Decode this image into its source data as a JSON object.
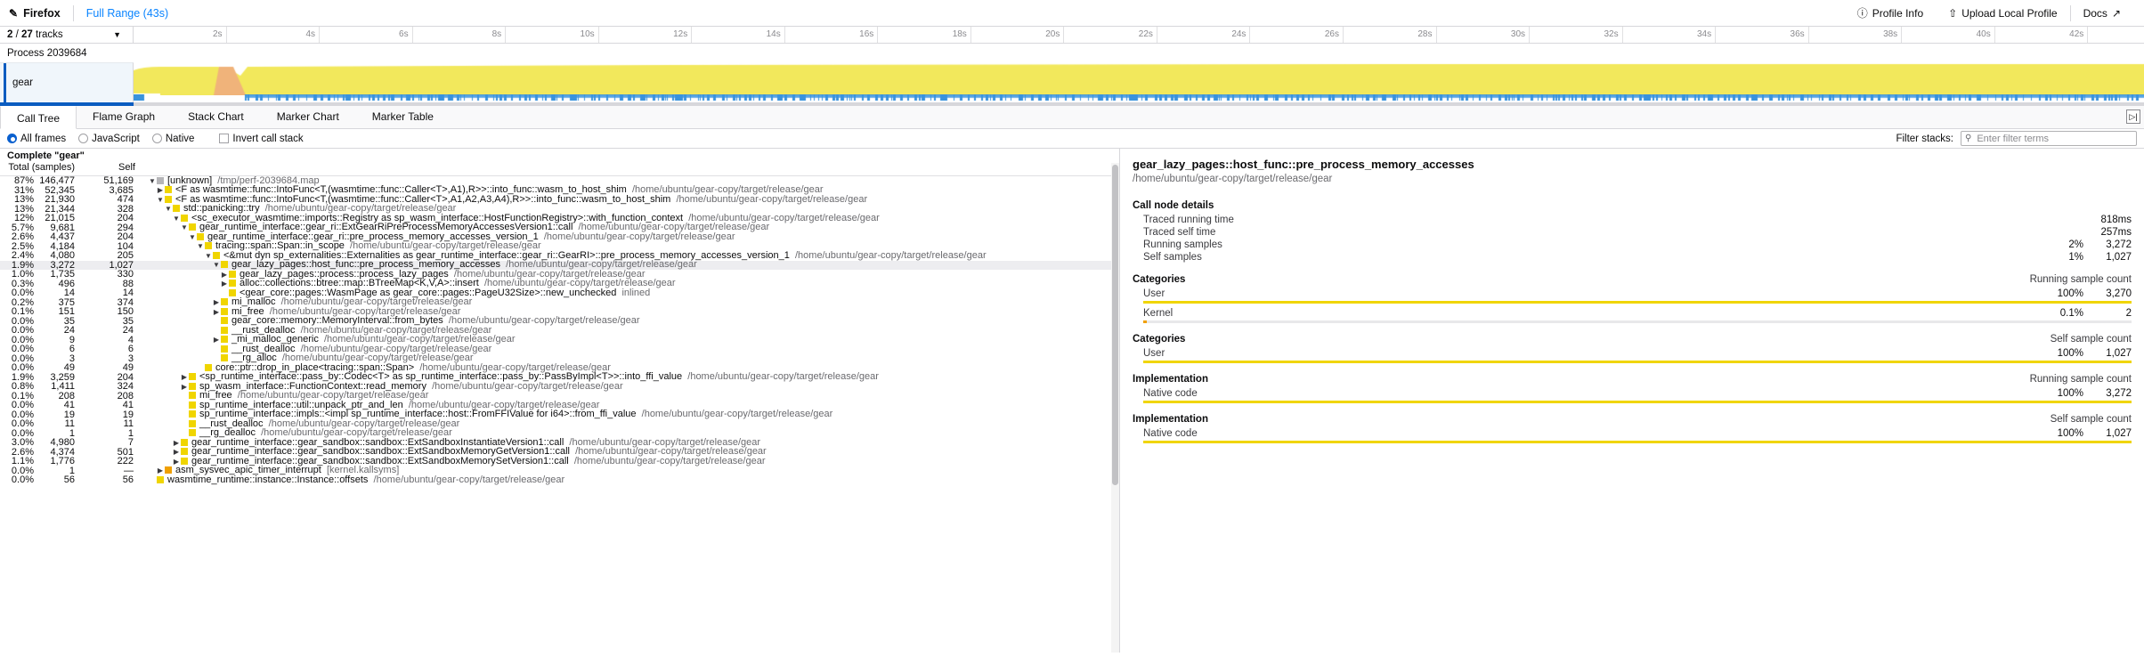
{
  "appbar": {
    "brand": "Firefox",
    "pencil_icon": "pencil-icon",
    "full_range": "Full Range (43s)",
    "profile_info": "Profile Info",
    "upload_local_profile": "Upload Local Profile",
    "docs": "Docs",
    "info_icon": "info-circle-icon",
    "upload_icon": "upload-icon",
    "external_icon": "external-link-icon"
  },
  "timeline": {
    "tracks_selected": "2",
    "tracks_total": "27",
    "tracks_suffix": "tracks",
    "ticks": [
      "2s",
      "4s",
      "6s",
      "8s",
      "10s",
      "12s",
      "14s",
      "16s",
      "18s",
      "20s",
      "22s",
      "24s",
      "26s",
      "28s",
      "30s",
      "32s",
      "34s",
      "36s",
      "38s",
      "40s",
      "42s"
    ],
    "process_label": "Process 2039684",
    "track_name": "gear",
    "activity_color": "#f2e85c",
    "activity_alt_color": "#f0b37a",
    "samples_color": "#3a93dd"
  },
  "tabs": {
    "items": [
      {
        "label": "Call Tree",
        "active": true
      },
      {
        "label": "Flame Graph",
        "active": false
      },
      {
        "label": "Stack Chart",
        "active": false
      },
      {
        "label": "Marker Chart",
        "active": false
      },
      {
        "label": "Marker Table",
        "active": false
      }
    ],
    "sidebar_toggle_icon": "sidebar-toggle-icon"
  },
  "filters": {
    "all_frames": "All frames",
    "javascript": "JavaScript",
    "native": "Native",
    "invert_call_stack": "Invert call stack",
    "selected_frame_filter": "All frames",
    "invert_checked": false,
    "filter_stacks_label": "Filter stacks:",
    "search_placeholder": "Enter filter terms",
    "search_value": "",
    "search_icon": "search-icon"
  },
  "tree": {
    "columns": [
      "Total (samples)",
      "Self",
      ""
    ],
    "col_total": "Total (samples)",
    "col_self": "Self",
    "complete_label": "Complete \"gear\"",
    "rows": [
      {
        "pct": "87%",
        "total": "146,477",
        "self": "51,169",
        "depth": 0,
        "tw": "down",
        "sq": "g",
        "name": "[unknown]",
        "path": "/tmp/perf-2039684.map",
        "sel": false
      },
      {
        "pct": "31%",
        "total": "52,345",
        "self": "3,685",
        "depth": 1,
        "tw": "right",
        "sq": "y",
        "name": "<F as wasmtime::func::IntoFunc<T,(wasmtime::func::Caller<T>,A1),R>>::into_func::wasm_to_host_shim",
        "path": "/home/ubuntu/gear-copy/target/release/gear",
        "sel": false
      },
      {
        "pct": "13%",
        "total": "21,930",
        "self": "474",
        "depth": 1,
        "tw": "down",
        "sq": "y",
        "name": "<F as wasmtime::func::IntoFunc<T,(wasmtime::func::Caller<T>,A1,A2,A3,A4),R>>::into_func::wasm_to_host_shim",
        "path": "/home/ubuntu/gear-copy/target/release/gear",
        "sel": false
      },
      {
        "pct": "13%",
        "total": "21,344",
        "self": "328",
        "depth": 2,
        "tw": "down",
        "sq": "y",
        "name": "std::panicking::try",
        "path": "/home/ubuntu/gear-copy/target/release/gear",
        "sel": false
      },
      {
        "pct": "12%",
        "total": "21,015",
        "self": "204",
        "depth": 3,
        "tw": "down",
        "sq": "y",
        "name": "<sc_executor_wasmtime::imports::Registry as sp_wasm_interface::HostFunctionRegistry>::with_function_context",
        "path": "/home/ubuntu/gear-copy/target/release/gear",
        "sel": false
      },
      {
        "pct": "5.7%",
        "total": "9,681",
        "self": "294",
        "depth": 4,
        "tw": "down",
        "sq": "y",
        "name": "gear_runtime_interface::gear_ri::ExtGearRiPreProcessMemoryAccessesVersion1::call",
        "path": "/home/ubuntu/gear-copy/target/release/gear",
        "sel": false
      },
      {
        "pct": "2.6%",
        "total": "4,437",
        "self": "204",
        "depth": 5,
        "tw": "down",
        "sq": "y",
        "name": "gear_runtime_interface::gear_ri::pre_process_memory_accesses_version_1",
        "path": "/home/ubuntu/gear-copy/target/release/gear",
        "sel": false
      },
      {
        "pct": "2.5%",
        "total": "4,184",
        "self": "104",
        "depth": 6,
        "tw": "down",
        "sq": "y",
        "name": "tracing::span::Span::in_scope",
        "path": "/home/ubuntu/gear-copy/target/release/gear",
        "sel": false
      },
      {
        "pct": "2.4%",
        "total": "4,080",
        "self": "205",
        "depth": 7,
        "tw": "down",
        "sq": "y",
        "name": "<&mut dyn sp_externalities::Externalities as gear_runtime_interface::gear_ri::GearRI>::pre_process_memory_accesses_version_1",
        "path": "/home/ubuntu/gear-copy/target/release/gear",
        "sel": false
      },
      {
        "pct": "1.9%",
        "total": "3,272",
        "self": "1,027",
        "depth": 8,
        "tw": "down",
        "sq": "y",
        "name": "gear_lazy_pages::host_func::pre_process_memory_accesses",
        "path": "/home/ubuntu/gear-copy/target/release/gear",
        "sel": true
      },
      {
        "pct": "1.0%",
        "total": "1,735",
        "self": "330",
        "depth": 9,
        "tw": "right",
        "sq": "y",
        "name": "gear_lazy_pages::process::process_lazy_pages",
        "path": "/home/ubuntu/gear-copy/target/release/gear",
        "sel": false
      },
      {
        "pct": "0.3%",
        "total": "496",
        "self": "88",
        "depth": 9,
        "tw": "right",
        "sq": "y",
        "name": "alloc::collections::btree::map::BTreeMap<K,V,A>::insert",
        "path": "/home/ubuntu/gear-copy/target/release/gear",
        "sel": false
      },
      {
        "pct": "0.0%",
        "total": "14",
        "self": "14",
        "depth": 9,
        "tw": "blank",
        "sq": "y",
        "name": "<gear_core::pages::WasmPage as gear_core::pages::PageU32Size>::new_unchecked",
        "path": "inlined",
        "sel": false
      },
      {
        "pct": "0.2%",
        "total": "375",
        "self": "374",
        "depth": 8,
        "tw": "right",
        "sq": "y",
        "name": "mi_malloc",
        "path": "/home/ubuntu/gear-copy/target/release/gear",
        "sel": false
      },
      {
        "pct": "0.1%",
        "total": "151",
        "self": "150",
        "depth": 8,
        "tw": "right",
        "sq": "y",
        "name": "mi_free",
        "path": "/home/ubuntu/gear-copy/target/release/gear",
        "sel": false
      },
      {
        "pct": "0.0%",
        "total": "35",
        "self": "35",
        "depth": 8,
        "tw": "blank",
        "sq": "y",
        "name": "gear_core::memory::MemoryInterval::from_bytes",
        "path": "/home/ubuntu/gear-copy/target/release/gear",
        "sel": false
      },
      {
        "pct": "0.0%",
        "total": "24",
        "self": "24",
        "depth": 8,
        "tw": "blank",
        "sq": "y",
        "name": "__rust_dealloc",
        "path": "/home/ubuntu/gear-copy/target/release/gear",
        "sel": false
      },
      {
        "pct": "0.0%",
        "total": "9",
        "self": "4",
        "depth": 8,
        "tw": "right",
        "sq": "y",
        "name": "_mi_malloc_generic",
        "path": "/home/ubuntu/gear-copy/target/release/gear",
        "sel": false
      },
      {
        "pct": "0.0%",
        "total": "6",
        "self": "6",
        "depth": 8,
        "tw": "blank",
        "sq": "y",
        "name": "__rust_dealloc",
        "path": "/home/ubuntu/gear-copy/target/release/gear",
        "sel": false
      },
      {
        "pct": "0.0%",
        "total": "3",
        "self": "3",
        "depth": 8,
        "tw": "blank",
        "sq": "y",
        "name": "__rg_alloc",
        "path": "/home/ubuntu/gear-copy/target/release/gear",
        "sel": false
      },
      {
        "pct": "0.0%",
        "total": "49",
        "self": "49",
        "depth": 6,
        "tw": "blank",
        "sq": "y",
        "name": "core::ptr::drop_in_place<tracing::span::Span>",
        "path": "/home/ubuntu/gear-copy/target/release/gear",
        "sel": false
      },
      {
        "pct": "1.9%",
        "total": "3,259",
        "self": "204",
        "depth": 4,
        "tw": "right",
        "sq": "y",
        "name": "<sp_runtime_interface::pass_by::Codec<T> as sp_runtime_interface::pass_by::PassByImpl<T>>::into_ffi_value",
        "path": "/home/ubuntu/gear-copy/target/release/gear",
        "sel": false
      },
      {
        "pct": "0.8%",
        "total": "1,411",
        "self": "324",
        "depth": 4,
        "tw": "right",
        "sq": "y",
        "name": "sp_wasm_interface::FunctionContext::read_memory",
        "path": "/home/ubuntu/gear-copy/target/release/gear",
        "sel": false
      },
      {
        "pct": "0.1%",
        "total": "208",
        "self": "208",
        "depth": 4,
        "tw": "blank",
        "sq": "y",
        "name": "mi_free",
        "path": "/home/ubuntu/gear-copy/target/release/gear",
        "sel": false
      },
      {
        "pct": "0.0%",
        "total": "41",
        "self": "41",
        "depth": 4,
        "tw": "blank",
        "sq": "y",
        "name": "sp_runtime_interface::util::unpack_ptr_and_len",
        "path": "/home/ubuntu/gear-copy/target/release/gear",
        "sel": false
      },
      {
        "pct": "0.0%",
        "total": "19",
        "self": "19",
        "depth": 4,
        "tw": "blank",
        "sq": "y",
        "name": "sp_runtime_interface::impls::<impl sp_runtime_interface::host::FromFFIValue for i64>::from_ffi_value",
        "path": "/home/ubuntu/gear-copy/target/release/gear",
        "sel": false
      },
      {
        "pct": "0.0%",
        "total": "11",
        "self": "11",
        "depth": 4,
        "tw": "blank",
        "sq": "y",
        "name": "__rust_dealloc",
        "path": "/home/ubuntu/gear-copy/target/release/gear",
        "sel": false
      },
      {
        "pct": "0.0%",
        "total": "1",
        "self": "1",
        "depth": 4,
        "tw": "blank",
        "sq": "y",
        "name": "__rg_dealloc",
        "path": "/home/ubuntu/gear-copy/target/release/gear",
        "sel": false
      },
      {
        "pct": "3.0%",
        "total": "4,980",
        "self": "7",
        "depth": 3,
        "tw": "right",
        "sq": "y",
        "name": "gear_runtime_interface::gear_sandbox::sandbox::ExtSandboxInstantiateVersion1::call",
        "path": "/home/ubuntu/gear-copy/target/release/gear",
        "sel": false
      },
      {
        "pct": "2.6%",
        "total": "4,374",
        "self": "501",
        "depth": 3,
        "tw": "right",
        "sq": "y",
        "name": "gear_runtime_interface::gear_sandbox::sandbox::ExtSandboxMemoryGetVersion1::call",
        "path": "/home/ubuntu/gear-copy/target/release/gear",
        "sel": false
      },
      {
        "pct": "1.1%",
        "total": "1,776",
        "self": "222",
        "depth": 3,
        "tw": "right",
        "sq": "y",
        "name": "gear_runtime_interface::gear_sandbox::sandbox::ExtSandboxMemorySetVersion1::call",
        "path": "/home/ubuntu/gear-copy/target/release/gear",
        "sel": false
      },
      {
        "pct": "0.0%",
        "total": "1",
        "self": "—",
        "depth": 1,
        "tw": "right",
        "sq": "o",
        "name": "asm_sysvec_apic_timer_interrupt",
        "path": "[kernel.kallsyms]",
        "sel": false
      },
      {
        "pct": "0.0%",
        "total": "56",
        "self": "56",
        "depth": 0,
        "tw": "blank",
        "sq": "y",
        "name": "wasmtime_runtime::instance::Instance::offsets",
        "path": "/home/ubuntu/gear-copy/target/release/gear",
        "sel": false
      }
    ]
  },
  "sidebar": {
    "function_name": "gear_lazy_pages::host_func::pre_process_memory_accesses",
    "file_path": "/home/ubuntu/gear-copy/target/release/gear",
    "call_node_details_heading": "Call node details",
    "details": [
      {
        "label": "Traced running time",
        "v1": "",
        "v2": "818ms"
      },
      {
        "label": "Traced self time",
        "v1": "",
        "v2": "257ms"
      },
      {
        "label": "Running samples",
        "v1": "2%",
        "v2": "3,272"
      },
      {
        "label": "Self samples",
        "v1": "1%",
        "v2": "1,027"
      }
    ],
    "categories_running_heading": "Categories",
    "categories_running_right": "Running sample count",
    "categories_running": [
      {
        "label": "User",
        "v1": "100%",
        "v2": "3,270",
        "bar": 100,
        "color": "#f0d500"
      },
      {
        "label": "Kernel",
        "v1": "0.1%",
        "v2": "2",
        "bar": 0.4,
        "color": "#f0a000"
      }
    ],
    "categories_self_heading": "Categories",
    "categories_self_right": "Self sample count",
    "categories_self": [
      {
        "label": "User",
        "v1": "100%",
        "v2": "1,027",
        "bar": 100,
        "color": "#f0d500"
      }
    ],
    "impl_running_heading": "Implementation",
    "impl_running_right": "Running sample count",
    "impl_running": [
      {
        "label": "Native code",
        "v1": "100%",
        "v2": "3,272",
        "bar": 100,
        "color": "#f0d500"
      }
    ],
    "impl_self_heading": "Implementation",
    "impl_self_right": "Self sample count",
    "impl_self": [
      {
        "label": "Native code",
        "v1": "100%",
        "v2": "1,027",
        "bar": 100,
        "color": "#f0d500"
      }
    ]
  }
}
